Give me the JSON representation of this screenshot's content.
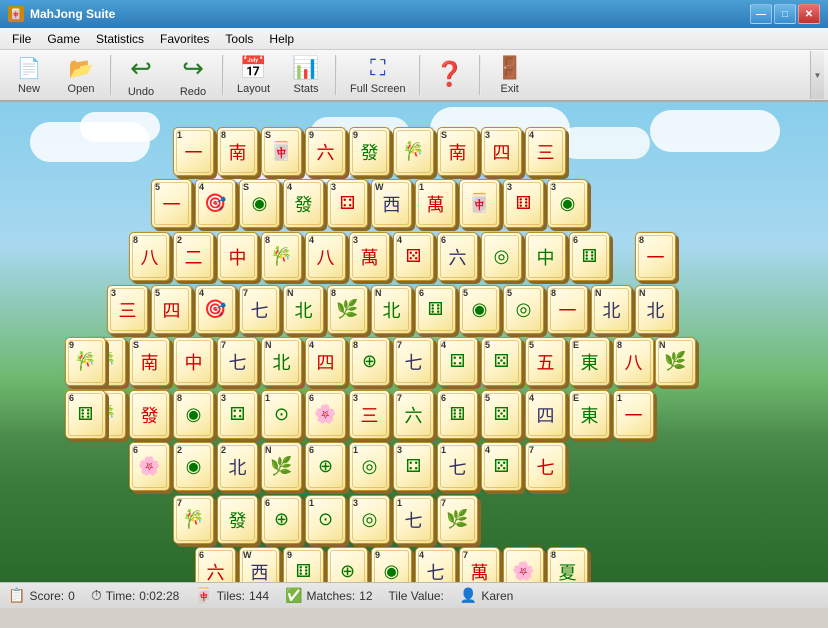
{
  "window": {
    "title": "MahJong Suite",
    "icon": "🀄"
  },
  "titlebar": {
    "minimize_label": "—",
    "maximize_label": "□",
    "close_label": "✕"
  },
  "menu": {
    "items": [
      "File",
      "Game",
      "Statistics",
      "Favorites",
      "Tools",
      "Help"
    ]
  },
  "toolbar": {
    "buttons": [
      {
        "id": "new",
        "label": "New",
        "icon": "📄"
      },
      {
        "id": "open",
        "label": "Open",
        "icon": "📂"
      },
      {
        "id": "undo",
        "label": "Undo",
        "icon": "↩"
      },
      {
        "id": "redo",
        "label": "Redo",
        "icon": "↪"
      },
      {
        "id": "layout",
        "label": "Layout",
        "icon": "📅"
      },
      {
        "id": "stats",
        "label": "Stats",
        "icon": "📊"
      },
      {
        "id": "fullscreen",
        "label": "Full Screen",
        "icon": "⛶"
      },
      {
        "id": "help",
        "label": "?",
        "icon": "❓"
      },
      {
        "id": "exit",
        "label": "Exit",
        "icon": "🚪"
      }
    ]
  },
  "statusbar": {
    "score_label": "Score:",
    "score_value": "0",
    "time_label": "Time:",
    "time_value": "0:02:28",
    "tiles_label": "Tiles:",
    "tiles_value": "144",
    "matches_label": "Matches:",
    "matches_value": "12",
    "tilevalue_label": "Tile Value:",
    "user_label": "Karen"
  },
  "colors": {
    "sky_top": "#87CEEB",
    "sky_bottom": "#b0ddf0",
    "grass": "#5a9e5a",
    "tile_bg": "#fffdf0",
    "tile_border": "#b8902a",
    "tile_shadow": "#8b6828",
    "red_tile": "#cc0000",
    "green_tile": "#007700",
    "blue_tile": "#000088"
  }
}
